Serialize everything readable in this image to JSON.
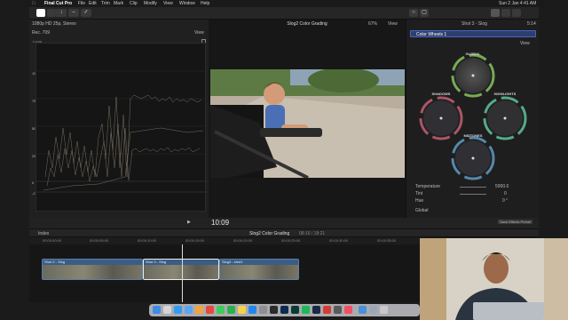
{
  "menubar": {
    "app": "Final Cut Pro",
    "items": [
      "File",
      "Edit",
      "Trim",
      "Mark",
      "Clip",
      "Modify",
      "View",
      "Window",
      "Help"
    ],
    "clock": "Sun 2 Jan 4:41 AM"
  },
  "viewer": {
    "format": "1080p HD 25p, Stereo",
    "title": "Slog2 Color Grading",
    "zoom": "67%",
    "view_label": "View",
    "timecode": "10:09"
  },
  "scope": {
    "name": "Rec. 709",
    "view_label": "View",
    "unit": "Luma",
    "ticks": [
      "100",
      "75",
      "50",
      "25",
      "0",
      "-2"
    ]
  },
  "inspector": {
    "clip": "Shot 3 - Slog",
    "duration": "5:14",
    "effect": "Color Wheels 1",
    "view_label": "View",
    "wheels": [
      "GLOBAL",
      "SHADOWS",
      "HIGHLIGHTS",
      "MIDTONES"
    ],
    "params": [
      {
        "label": "Temperature",
        "value": "5000.0"
      },
      {
        "label": "Tint",
        "value": "0"
      },
      {
        "label": "Hue",
        "value": "0 °"
      }
    ],
    "section": "Global",
    "save_btn": "Save Effects Preset"
  },
  "timeline": {
    "index_label": "Index",
    "project": "Slog2 Color Grading",
    "duration": "08:16 / 18:21",
    "ruler": [
      "00:00:00:00",
      "00:00:05:00",
      "00:00:10:00",
      "00:00:15:00",
      "00:00:20:00",
      "00:00:25:00",
      "00:00:30:00",
      "00:00:35:00"
    ],
    "clips": [
      "Shot 2 - Slog",
      "Shot 3 - Slog",
      "Slog3 - shot1"
    ]
  },
  "colors": {
    "accent": "#5b8cff",
    "clip": "#3a5d85",
    "selected": "#d9d9d9"
  }
}
